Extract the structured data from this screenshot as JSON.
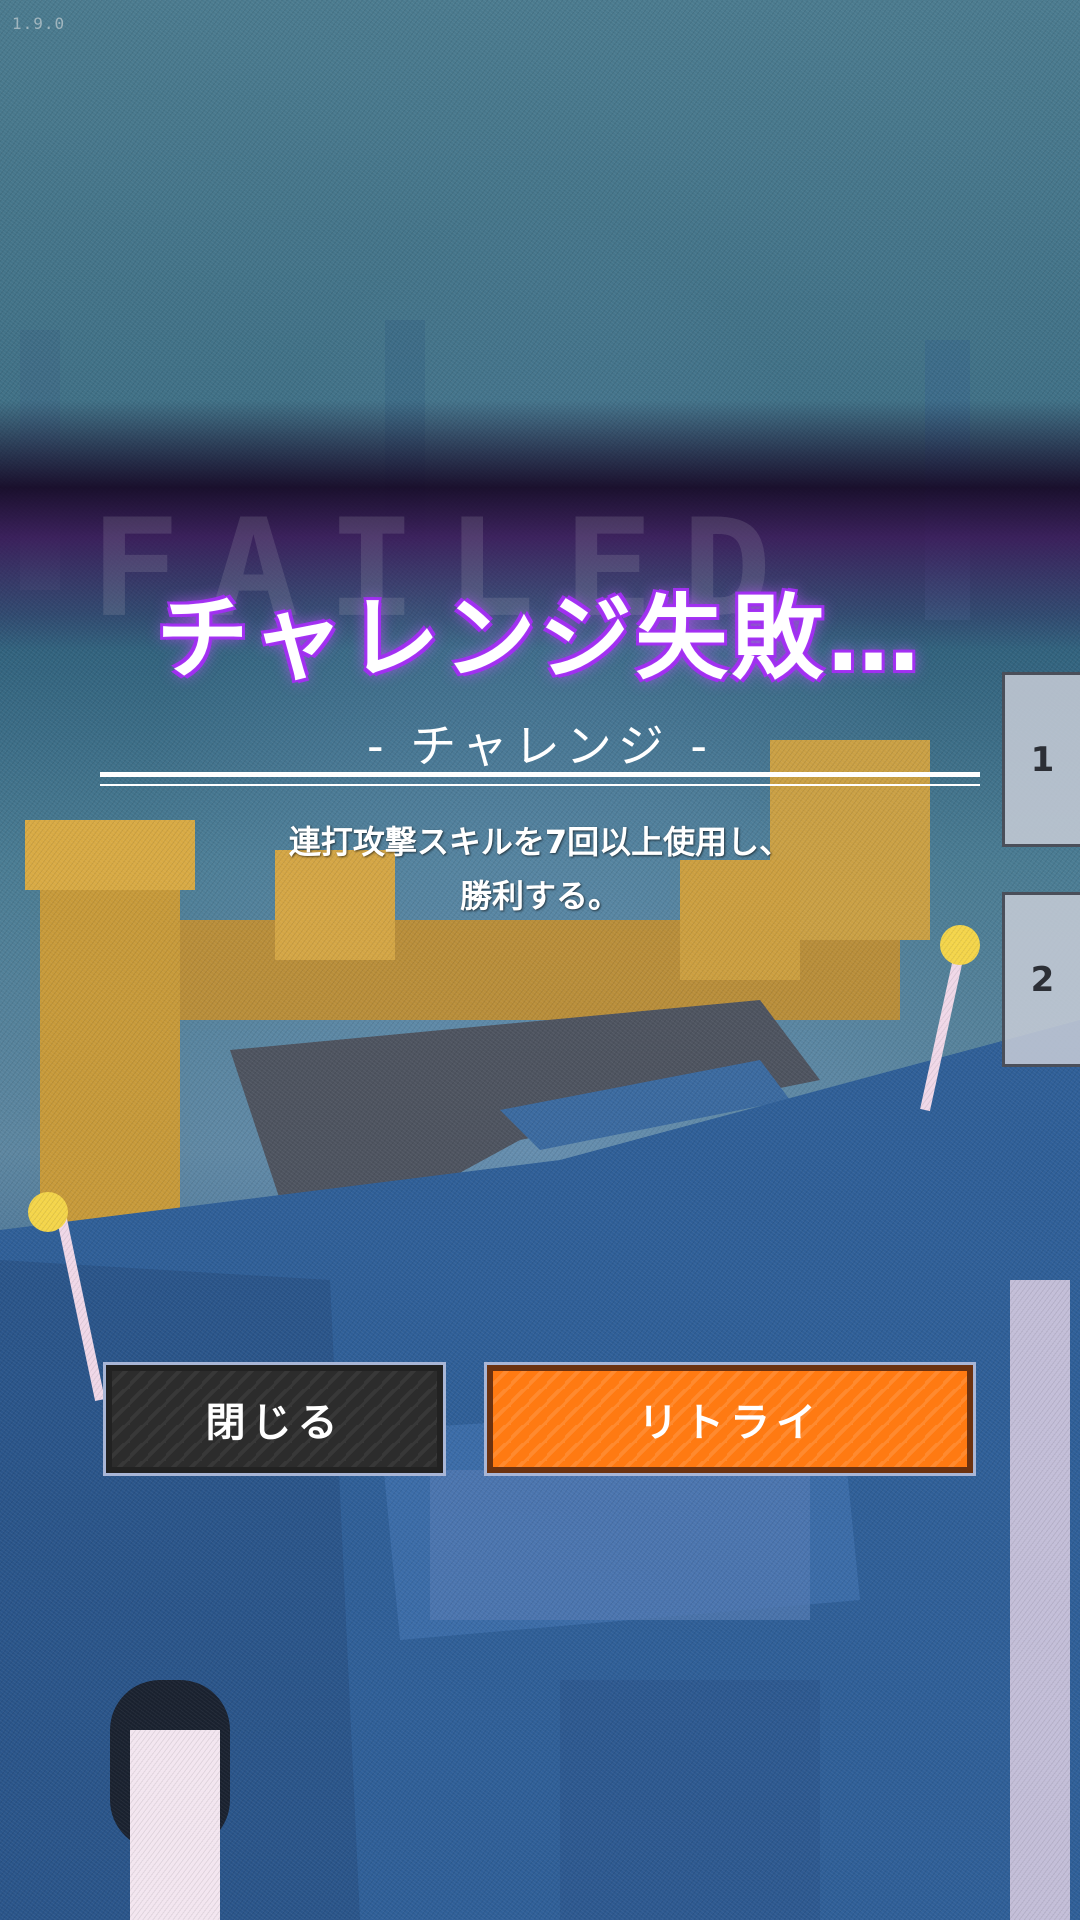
{
  "version": "1.9.0",
  "ghost_text": "FAILED",
  "dialog": {
    "title": "チャレンジ失敗…",
    "subtitle": "- チャレンジ -",
    "description_line1": "連打攻撃スキルを7回以上使用し、",
    "description_line2": "勝利する。"
  },
  "side_tabs": [
    "1",
    "2"
  ],
  "buttons": {
    "close_label": "閉じる",
    "retry_label": "リトライ"
  },
  "colors": {
    "title_glow": "#a030f0",
    "retry": "#ff7a12",
    "close": "#2c2c2c"
  }
}
